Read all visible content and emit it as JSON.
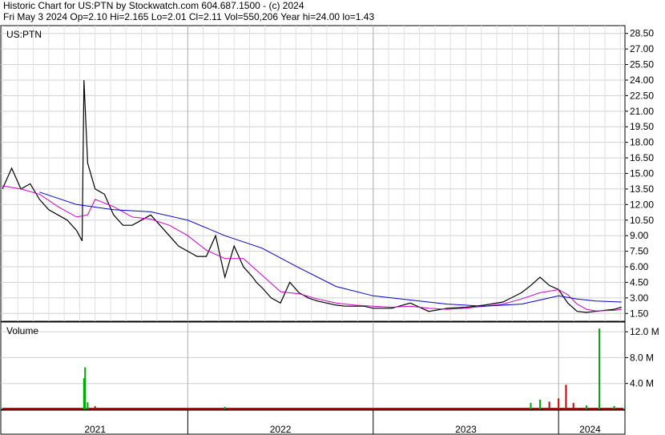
{
  "header": {
    "line1": "Historic Chart for US:PTN by Stockwatch.com 604.687.1500 - (c) 2024",
    "line2": "Fri May  3 2024   Op=2.10  Hi=2.165  Lo=2.01  Cl=2.11  Vol=550,206  Year hi=24.00  lo=1.43"
  },
  "chart_data": [
    {
      "type": "line",
      "title": "US:PTN",
      "price_ticks": [
        "28.50",
        "27.00",
        "25.50",
        "24.00",
        "22.50",
        "21.00",
        "19.50",
        "18.00",
        "16.50",
        "15.00",
        "13.50",
        "12.00",
        "10.50",
        "9.00",
        "7.50",
        "6.00",
        "4.50",
        "3.00",
        "1.50"
      ],
      "ylim": [
        0.75,
        29.25
      ],
      "x_labels": [
        "2021",
        "2022",
        "2023",
        "2024"
      ],
      "series": [
        {
          "color": "#000000",
          "x": [
            2021.0,
            2021.05,
            2021.1,
            2021.15,
            2021.2,
            2021.25,
            2021.3,
            2021.35,
            2021.4,
            2021.43,
            2021.44,
            2021.46,
            2021.5,
            2021.55,
            2021.6,
            2021.65,
            2021.7,
            2021.75,
            2021.8,
            2021.85,
            2021.9,
            2021.95,
            2022.0,
            2022.05,
            2022.1,
            2022.15,
            2022.2,
            2022.25,
            2022.3,
            2022.35,
            2022.37,
            2022.4,
            2022.45,
            2022.5,
            2022.55,
            2022.6,
            2022.65,
            2022.7,
            2022.75,
            2022.8,
            2022.85,
            2022.9,
            2022.95,
            2023.0,
            2023.1,
            2023.2,
            2023.3,
            2023.4,
            2023.5,
            2023.6,
            2023.7,
            2023.8,
            2023.85,
            2023.9,
            2023.95,
            2024.0,
            2024.05,
            2024.1,
            2024.15,
            2024.2,
            2024.25,
            2024.3,
            2024.34
          ],
          "values": [
            13.5,
            15.5,
            13.5,
            14.0,
            12.5,
            11.5,
            11.0,
            10.5,
            9.5,
            8.5,
            24.0,
            16.0,
            13.5,
            13.0,
            11.0,
            10.0,
            10.0,
            10.5,
            11.0,
            10.0,
            9.0,
            8.0,
            7.5,
            7.0,
            7.0,
            9.0,
            5.0,
            8.0,
            6.0,
            5.0,
            4.5,
            4.0,
            3.0,
            2.5,
            4.5,
            3.5,
            3.0,
            2.7,
            2.5,
            2.3,
            2.2,
            2.2,
            2.2,
            2.0,
            2.0,
            2.5,
            1.7,
            2.0,
            2.1,
            2.3,
            2.6,
            3.5,
            4.2,
            5.0,
            4.2,
            3.8,
            2.5,
            1.7,
            1.6,
            1.7,
            1.8,
            1.9,
            2.11
          ]
        },
        {
          "color": "#cc00cc",
          "x": [
            2021.0,
            2021.1,
            2021.2,
            2021.3,
            2021.4,
            2021.46,
            2021.5,
            2021.6,
            2021.7,
            2021.8,
            2021.9,
            2022.0,
            2022.1,
            2022.2,
            2022.3,
            2022.4,
            2022.5,
            2022.6,
            2022.7,
            2022.8,
            2022.9,
            2023.0,
            2023.1,
            2023.2,
            2023.3,
            2023.4,
            2023.5,
            2023.6,
            2023.7,
            2023.8,
            2023.9,
            2024.0,
            2024.05,
            2024.1,
            2024.15,
            2024.2,
            2024.3,
            2024.34
          ],
          "values": [
            13.8,
            13.5,
            13.0,
            11.8,
            10.8,
            11.0,
            12.5,
            11.8,
            10.8,
            10.6,
            10.0,
            9.0,
            7.6,
            6.8,
            6.8,
            5.2,
            3.6,
            3.4,
            2.9,
            2.5,
            2.3,
            2.2,
            2.1,
            2.2,
            2.0,
            1.9,
            2.0,
            2.2,
            2.4,
            2.9,
            3.5,
            3.8,
            3.3,
            2.4,
            1.9,
            1.75,
            1.8,
            1.9
          ]
        },
        {
          "color": "#0000cc",
          "x": [
            2021.2,
            2021.4,
            2021.6,
            2021.8,
            2022.0,
            2022.2,
            2022.4,
            2022.6,
            2022.8,
            2023.0,
            2023.2,
            2023.4,
            2023.6,
            2023.8,
            2023.9,
            2024.0,
            2024.1,
            2024.2,
            2024.34
          ],
          "values": [
            13.2,
            12.0,
            11.5,
            11.3,
            10.5,
            9.0,
            7.8,
            5.9,
            4.1,
            3.2,
            2.8,
            2.4,
            2.2,
            2.4,
            2.8,
            3.2,
            2.9,
            2.7,
            2.6
          ]
        }
      ]
    },
    {
      "type": "bar",
      "title": "Volume",
      "volume_ticks": [
        "12.0 M",
        "8.0 M",
        "4.0 M"
      ],
      "ylim": [
        0,
        13.5
      ],
      "bars": [
        {
          "x": 2021.44,
          "v": 4.8,
          "color": "#00aa00"
        },
        {
          "x": 2021.446,
          "v": 6.5,
          "color": "#00aa00"
        },
        {
          "x": 2021.46,
          "v": 1.1,
          "color": "#00aa00"
        },
        {
          "x": 2021.5,
          "v": 0.5,
          "color": "#cc0000"
        },
        {
          "x": 2022.2,
          "v": 0.4,
          "color": "#00aa00"
        },
        {
          "x": 2023.85,
          "v": 1.0,
          "color": "#00aa00"
        },
        {
          "x": 2023.9,
          "v": 1.5,
          "color": "#00aa00"
        },
        {
          "x": 2023.95,
          "v": 1.2,
          "color": "#cc0000"
        },
        {
          "x": 2024.0,
          "v": 1.7,
          "color": "#cc0000"
        },
        {
          "x": 2024.04,
          "v": 3.8,
          "color": "#cc0000"
        },
        {
          "x": 2024.08,
          "v": 1.0,
          "color": "#cc0000"
        },
        {
          "x": 2024.15,
          "v": 0.6,
          "color": "#00aa00"
        },
        {
          "x": 2024.22,
          "v": 12.5,
          "color": "#00aa00"
        },
        {
          "x": 2024.3,
          "v": 0.5,
          "color": "#00aa00"
        }
      ]
    }
  ]
}
